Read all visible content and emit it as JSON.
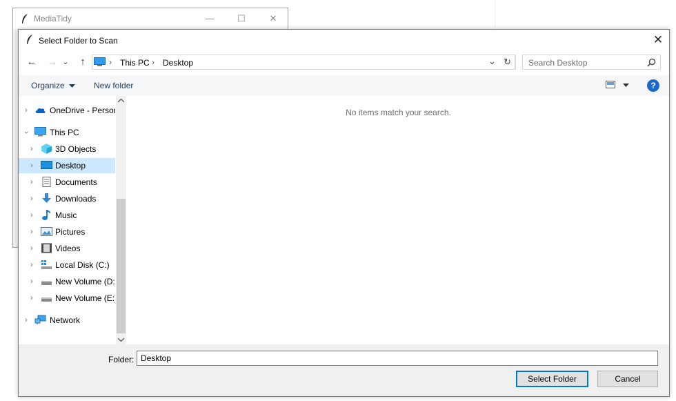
{
  "background_window": {
    "title": "MediaTidy",
    "minimize_glyph": "—",
    "maximize_glyph": "☐",
    "close_glyph": "✕"
  },
  "dialog": {
    "title": "Select Folder to Scan",
    "close_glyph": "✕"
  },
  "navigation": {
    "back_glyph": "←",
    "forward_glyph": "→",
    "recent_glyph": "⌄",
    "up_glyph": "↑",
    "breadcrumb": [
      "This PC",
      "Desktop"
    ],
    "separator": "›",
    "dropdown_glyph": "⌄",
    "refresh_glyph": "↻"
  },
  "search": {
    "placeholder": "Search Desktop"
  },
  "toolbar": {
    "organize_label": "Organize",
    "new_folder_label": "New folder",
    "help_glyph": "?"
  },
  "tree": {
    "items": [
      {
        "label": "OneDrive - Persor",
        "icon": "cloud-icon",
        "level": 0,
        "expanded": false
      },
      {
        "label": "This PC",
        "icon": "computer-icon",
        "level": 0,
        "expanded": true
      },
      {
        "label": "3D Objects",
        "icon": "cube-icon",
        "level": 1,
        "expanded": false
      },
      {
        "label": "Desktop",
        "icon": "desktop-icon",
        "level": 1,
        "expanded": false,
        "selected": true
      },
      {
        "label": "Documents",
        "icon": "document-icon",
        "level": 1,
        "expanded": false
      },
      {
        "label": "Downloads",
        "icon": "download-icon",
        "level": 1,
        "expanded": false
      },
      {
        "label": "Music",
        "icon": "music-icon",
        "level": 1,
        "expanded": false
      },
      {
        "label": "Pictures",
        "icon": "picture-icon",
        "level": 1,
        "expanded": false
      },
      {
        "label": "Videos",
        "icon": "video-icon",
        "level": 1,
        "expanded": false
      },
      {
        "label": "Local Disk (C:)",
        "icon": "system-drive-icon",
        "level": 1,
        "expanded": false
      },
      {
        "label": "New Volume (D:",
        "icon": "drive-icon",
        "level": 1,
        "expanded": false
      },
      {
        "label": "New Volume (E:)",
        "icon": "drive-icon",
        "level": 1,
        "expanded": false
      },
      {
        "label": "Network",
        "icon": "network-icon",
        "level": 0,
        "expanded": false
      }
    ]
  },
  "content": {
    "empty_message": "No items match your search."
  },
  "bottom": {
    "folder_label": "Folder:",
    "folder_value": "Desktop",
    "select_button": "Select Folder",
    "cancel_button": "Cancel"
  },
  "colors": {
    "accent": "#0078d7",
    "selection": "#cce8ff",
    "help": "#1b6ac9"
  }
}
